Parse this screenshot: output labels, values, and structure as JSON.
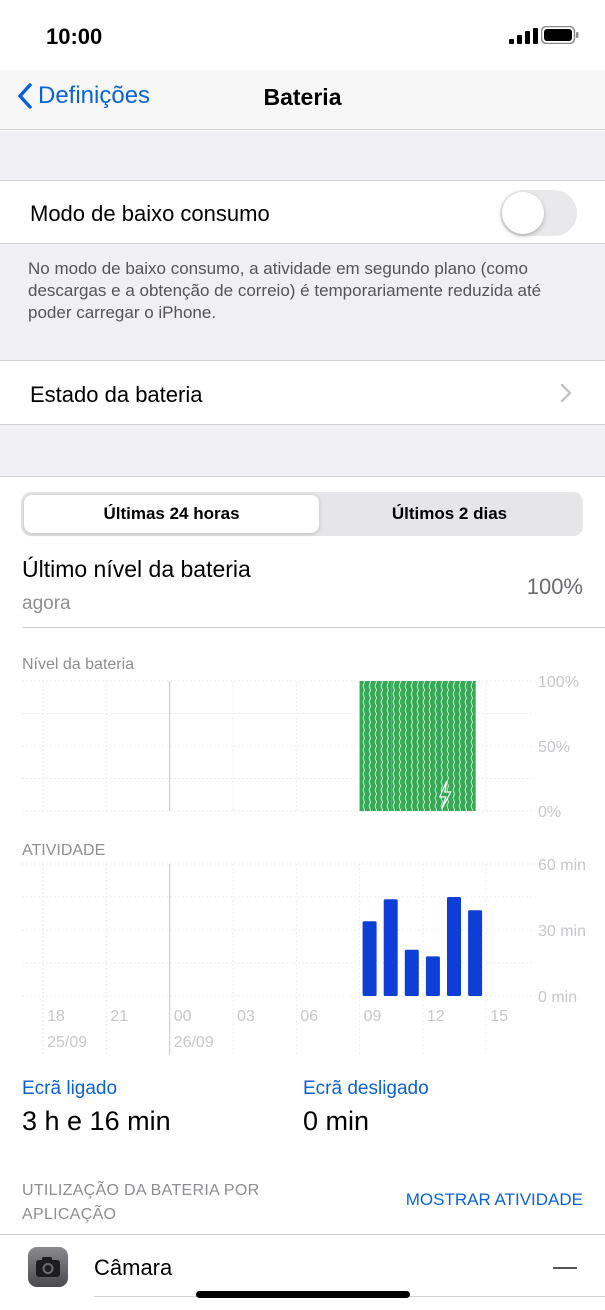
{
  "status_bar": {
    "time": "10:00"
  },
  "nav": {
    "back_label": "Definições",
    "title": "Bateria"
  },
  "low_power": {
    "label": "Modo de baixo consumo",
    "enabled": false,
    "footnote": "No modo de baixo consumo, a atividade em segundo plano (como descargas e a obtenção de correio) é temporariamente reduzida até poder carregar o iPhone."
  },
  "battery_health": {
    "label": "Estado da bateria"
  },
  "segments": {
    "active": "Últimas 24 horas",
    "inactive": "Últimos 2 dias"
  },
  "last_level": {
    "title": "Último nível da bateria",
    "subtitle": "agora",
    "value": "100%"
  },
  "battery_chart_title": "Nível da bateria",
  "activity_chart_title": "ATIVIDADE",
  "x_ticks": [
    "18",
    "21",
    "00",
    "03",
    "06",
    "09",
    "12",
    "15"
  ],
  "x_dates": [
    "25/09",
    "26/09"
  ],
  "stats": {
    "screen_on_label": "Ecrã ligado",
    "screen_on_value": "3 h e 16 min",
    "screen_off_label": "Ecrã desligado",
    "screen_off_value": "0 min"
  },
  "usage": {
    "header": "UTILIZAÇÃO DA BATERIA POR APLICAÇÃO",
    "action": "MOSTRAR ATIVIDADE"
  },
  "apps": [
    {
      "name": "Câmara",
      "icon": "camera-icon"
    }
  ],
  "colors": {
    "accent": "#0a63d6",
    "battery_bar": "#34a853",
    "activity_bar": "#0d3fd6"
  },
  "chart_data": [
    {
      "type": "bar",
      "title": "Nível da bateria",
      "ylim": [
        0,
        100
      ],
      "yticks": [
        "100%",
        "50%",
        "0%"
      ],
      "x_start_hour": 17,
      "x_end_hour": 17,
      "charging_shown": true,
      "bars": [
        {
          "hour": 9,
          "value": 100
        },
        {
          "hour": 9.5,
          "value": 100
        },
        {
          "hour": 10,
          "value": 100
        },
        {
          "hour": 10.5,
          "value": 100
        },
        {
          "hour": 11,
          "value": 100
        },
        {
          "hour": 11.5,
          "value": 100
        },
        {
          "hour": 12,
          "value": 100
        },
        {
          "hour": 12.5,
          "value": 100
        },
        {
          "hour": 13,
          "value": 100
        },
        {
          "hour": 13.5,
          "value": 100
        },
        {
          "hour": 14,
          "value": 100
        }
      ]
    },
    {
      "type": "bar",
      "title": "ATIVIDADE",
      "ylim": [
        0,
        60
      ],
      "yticks": [
        "60 min",
        "30 min",
        "0 min"
      ],
      "x_start_hour": 17,
      "x_end_hour": 17,
      "bars": [
        {
          "hour": 9,
          "value": 34
        },
        {
          "hour": 10,
          "value": 44
        },
        {
          "hour": 11,
          "value": 21
        },
        {
          "hour": 12,
          "value": 18
        },
        {
          "hour": 13,
          "value": 45
        },
        {
          "hour": 14,
          "value": 39
        }
      ]
    }
  ]
}
